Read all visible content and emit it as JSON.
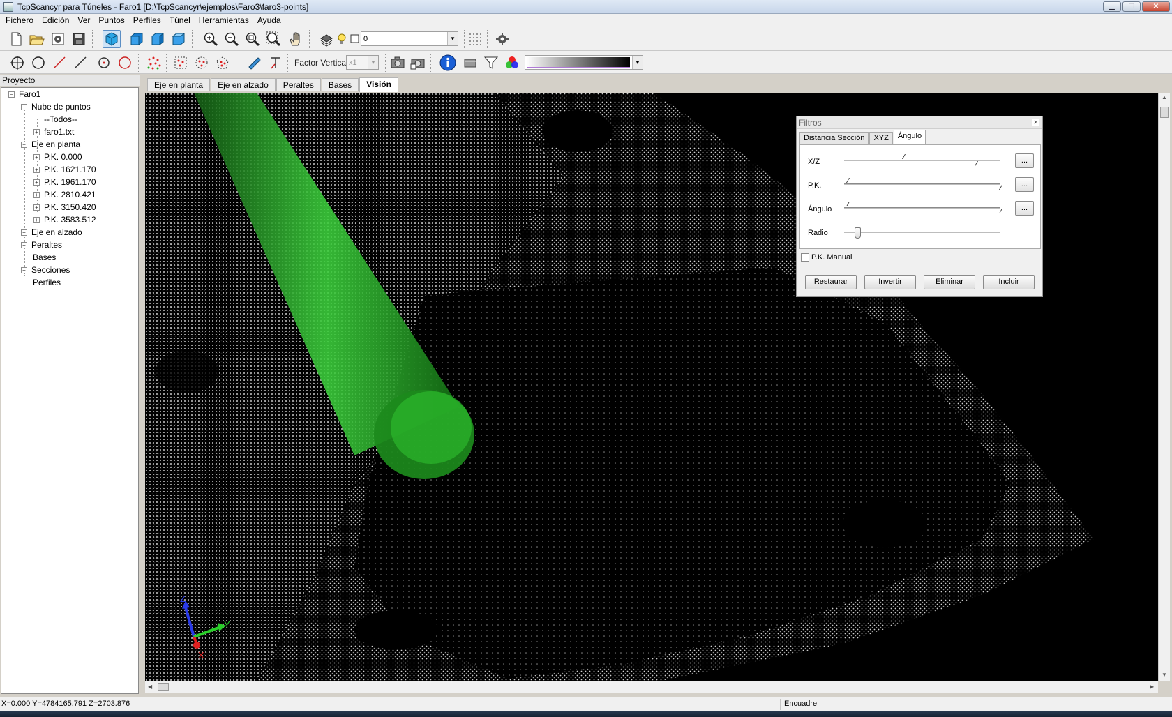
{
  "window": {
    "title": "TcpScancyr para Túneles - Faro1 [D:\\TcpScancyr\\ejemplos\\Faro3\\faro3-points]",
    "minimize": "▁",
    "restore": "❐",
    "close": "✕"
  },
  "menu": [
    "Fichero",
    "Edición",
    "Ver",
    "Puntos",
    "Perfiles",
    "Túnel",
    "Herramientas",
    "Ayuda"
  ],
  "toolbar1": {
    "layer_combo_value": "0"
  },
  "toolbar2": {
    "factor_label": "Factor Vertical",
    "factor_value": "x1"
  },
  "project_panel": {
    "header": "Proyecto",
    "tree": {
      "root": "Faro1",
      "nube": "Nube de puntos",
      "todos": "--Todos--",
      "faro_txt": "faro1.txt",
      "eje_planta": "Eje en planta",
      "pk": [
        "P.K. 0.000",
        "P.K. 1621.170",
        "P.K. 1961.170",
        "P.K. 2810.421",
        "P.K. 3150.420",
        "P.K. 3583.512"
      ],
      "eje_alzado": "Eje en alzado",
      "peraltes": "Peraltes",
      "bases": "Bases",
      "secciones": "Secciones",
      "perfiles": "Perfiles"
    }
  },
  "view_tabs": [
    "Eje en planta",
    "Eje en alzado",
    "Peraltes",
    "Bases",
    "Visión"
  ],
  "active_view_tab": "Visión",
  "axes": {
    "z": "Z",
    "y": "Y",
    "x": "X"
  },
  "filter_dialog": {
    "title": "Filtros",
    "tabs": [
      "Distancia Sección",
      "XYZ",
      "Ángulo"
    ],
    "active_tab": "Ángulo",
    "rows": [
      {
        "label": "X/Z",
        "button": "..."
      },
      {
        "label": "P.K.",
        "button": "..."
      },
      {
        "label": "Ángulo",
        "button": "..."
      },
      {
        "label": "Radio"
      }
    ],
    "pk_manual": "P.K. Manual",
    "buttons": {
      "restaurar": "Restaurar",
      "invertir": "Invertir",
      "eliminar": "Eliminar",
      "incluir": "Incluir"
    }
  },
  "status": {
    "coords": "X=0.000 Y=4784165.791 Z=2703.876",
    "mode": "Encuadre"
  },
  "colors": {
    "viewport_bg": "#000000",
    "cylinder": "#2fbf2f",
    "accent_pressed": "#cde3f7"
  }
}
